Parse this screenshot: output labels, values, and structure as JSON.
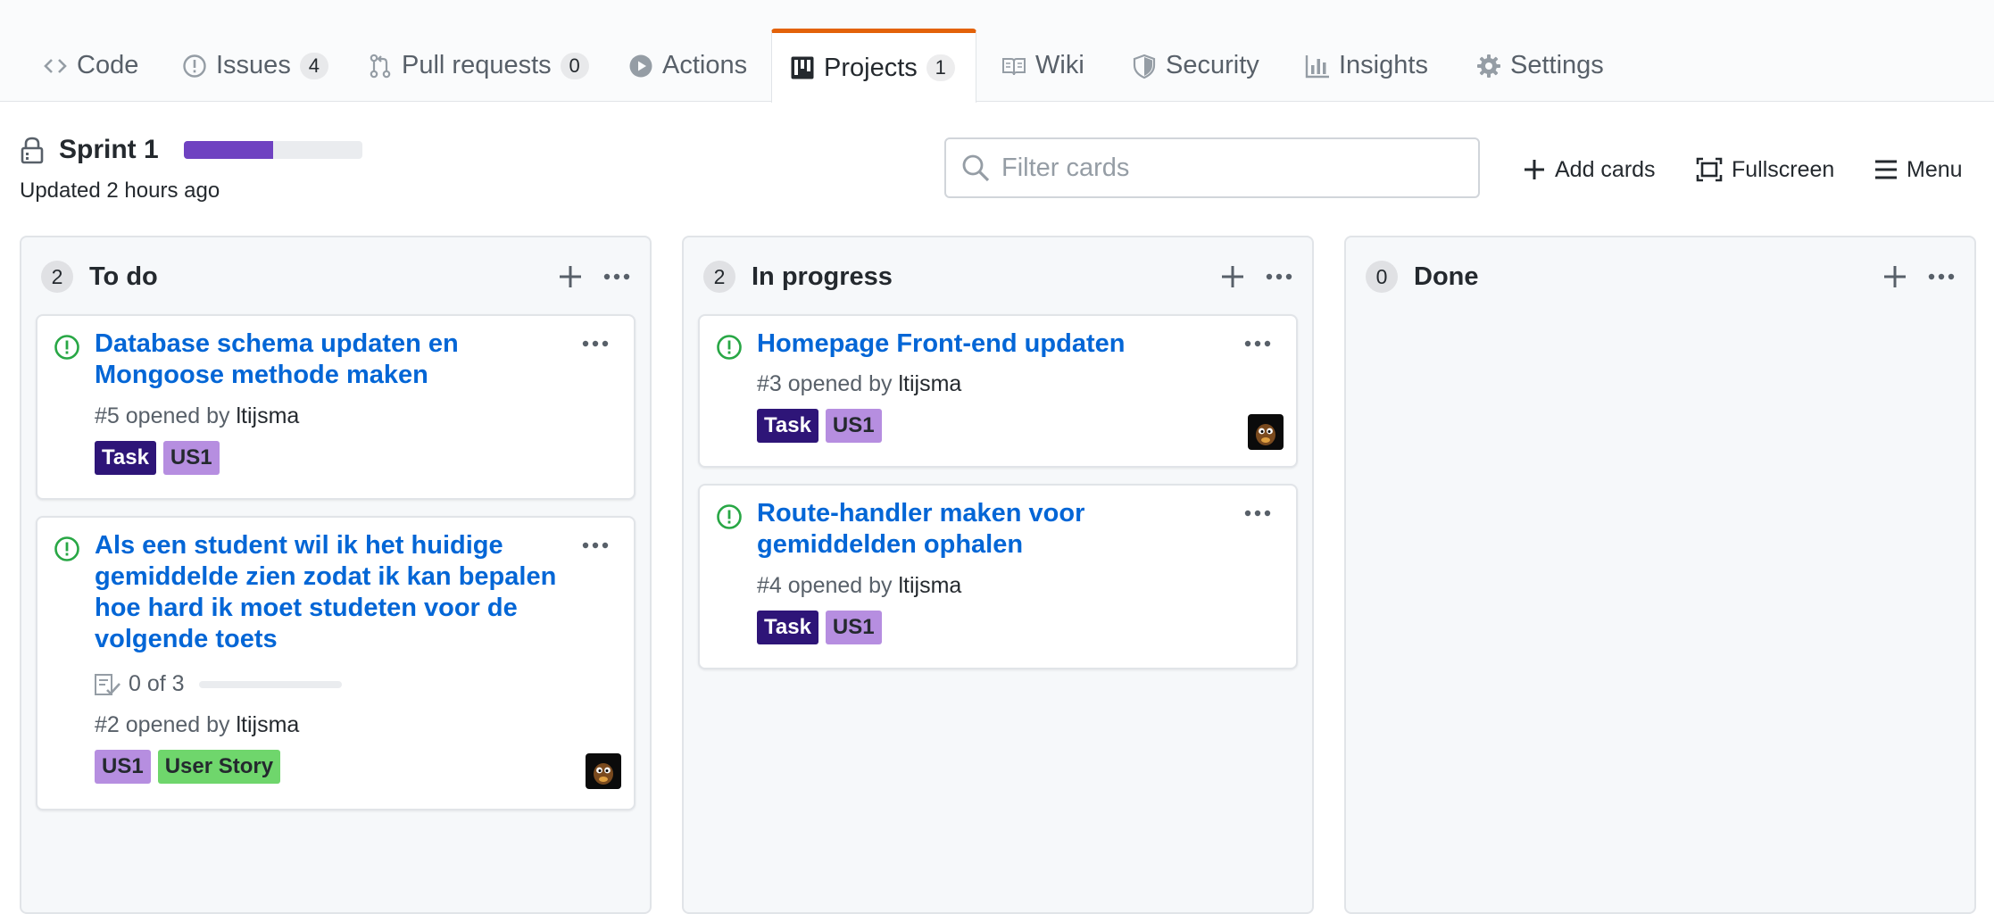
{
  "tabs": [
    {
      "label": "Code",
      "icon": "code-icon"
    },
    {
      "label": "Issues",
      "count": "4",
      "icon": "issue-icon"
    },
    {
      "label": "Pull requests",
      "count": "0",
      "icon": "pull-request-icon"
    },
    {
      "label": "Actions",
      "icon": "play-icon"
    },
    {
      "label": "Projects",
      "count": "1",
      "icon": "project-icon",
      "selected": true
    },
    {
      "label": "Wiki",
      "icon": "book-icon"
    },
    {
      "label": "Security",
      "icon": "shield-icon"
    },
    {
      "label": "Insights",
      "icon": "graph-icon"
    },
    {
      "label": "Settings",
      "icon": "gear-icon"
    }
  ],
  "project": {
    "name": "Sprint 1",
    "updated": "Updated 2 hours ago",
    "progress_fraction": 0.5,
    "progress_color": "#6f42c1"
  },
  "filter": {
    "placeholder": "Filter cards"
  },
  "header_actions": {
    "add_cards": "Add cards",
    "fullscreen": "Fullscreen",
    "menu": "Menu"
  },
  "columns": [
    {
      "name": "To do",
      "count": "2",
      "cards": [
        {
          "title": "Database schema updaten en Mongoose methode maken",
          "number": "#5",
          "opened_by": "opened by",
          "user": "ltijsma",
          "labels": [
            {
              "text": "Task",
              "bg": "#2e1578",
              "fg": "#ffffff"
            },
            {
              "text": "US1",
              "bg": "#b68ee0",
              "fg": "#24292e"
            }
          ],
          "avatar": false
        },
        {
          "title": "Als een student wil ik het huidige gemiddelde zien zodat ik kan bepalen hoe hard ik moet studeten voor de volgende toets",
          "number": "#2",
          "opened_by": "opened by",
          "user": "ltijsma",
          "tasks": "0 of 3",
          "tasks_done_fraction": 0,
          "labels": [
            {
              "text": "US1",
              "bg": "#b68ee0",
              "fg": "#24292e"
            },
            {
              "text": "User Story",
              "bg": "#6fd66c",
              "fg": "#24292e"
            }
          ],
          "avatar": true
        }
      ]
    },
    {
      "name": "In progress",
      "count": "2",
      "cards": [
        {
          "title": "Homepage Front-end updaten",
          "number": "#3",
          "opened_by": "opened by",
          "user": "ltijsma",
          "labels": [
            {
              "text": "Task",
              "bg": "#2e1578",
              "fg": "#ffffff"
            },
            {
              "text": "US1",
              "bg": "#b68ee0",
              "fg": "#24292e"
            }
          ],
          "avatar": true
        },
        {
          "title": "Route-handler maken voor gemiddelden ophalen",
          "number": "#4",
          "opened_by": "opened by",
          "user": "ltijsma",
          "labels": [
            {
              "text": "Task",
              "bg": "#2e1578",
              "fg": "#ffffff"
            },
            {
              "text": "US1",
              "bg": "#b68ee0",
              "fg": "#24292e"
            }
          ],
          "avatar": false
        }
      ]
    },
    {
      "name": "Done",
      "count": "0",
      "cards": []
    }
  ],
  "colors": {
    "link": "#0366d6",
    "open_issue": "#28a745",
    "accent_tab": "#e36209"
  }
}
